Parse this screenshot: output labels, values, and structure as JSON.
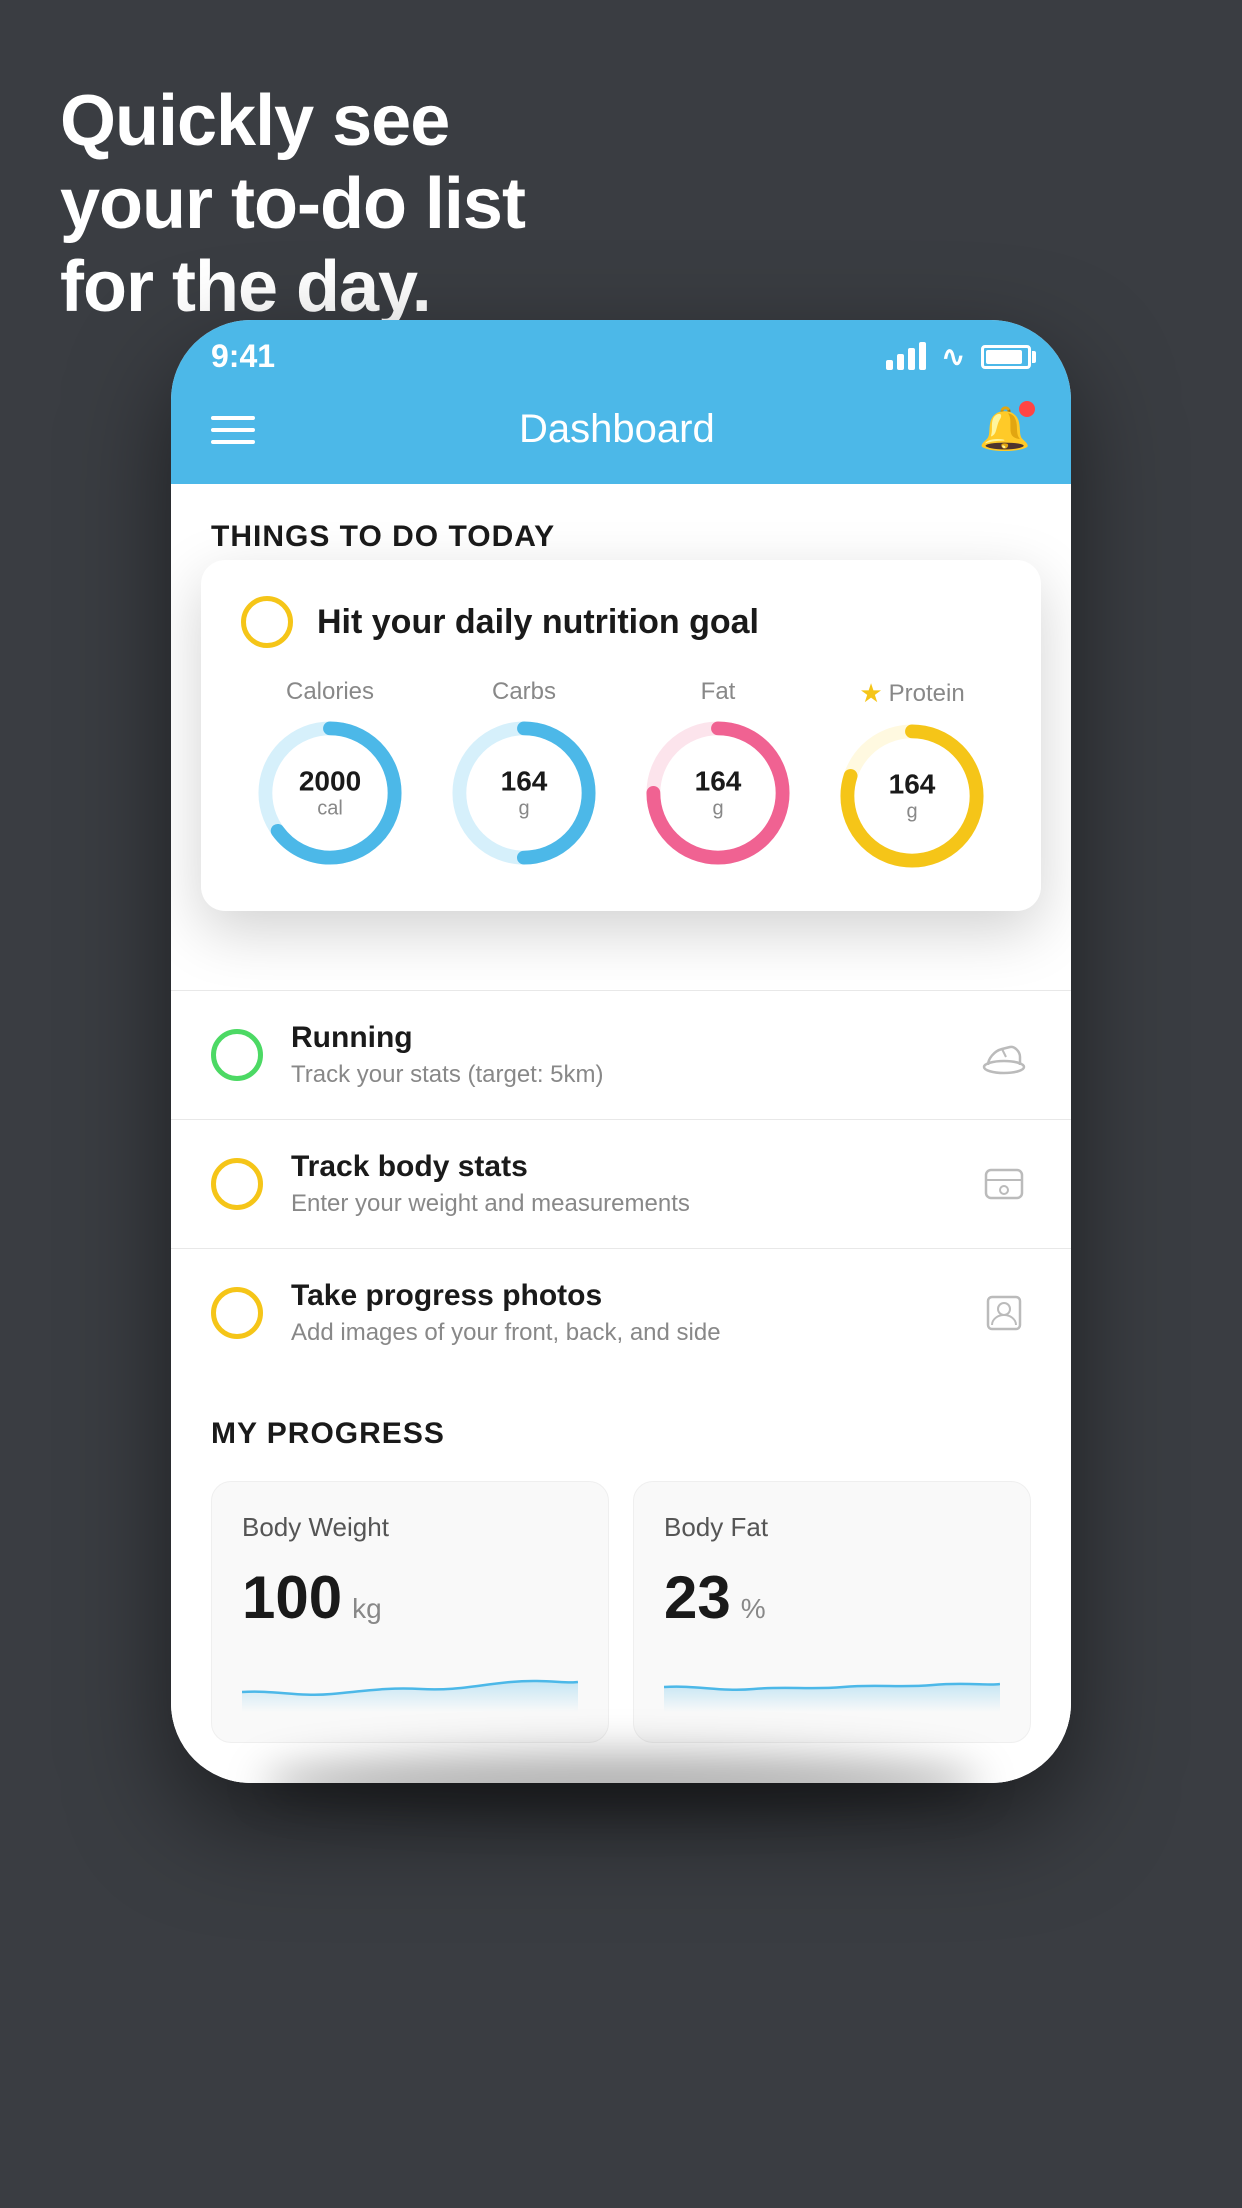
{
  "hero": {
    "line1": "Quickly see",
    "line2": "your to-do list",
    "line3": "for the day."
  },
  "status_bar": {
    "time": "9:41"
  },
  "header": {
    "title": "Dashboard"
  },
  "things_section": {
    "title": "THINGS TO DO TODAY"
  },
  "nutrition_card": {
    "title": "Hit your daily nutrition goal",
    "items": [
      {
        "label": "Calories",
        "value": "2000",
        "unit": "cal",
        "color": "#4cb8e8",
        "bg_color": "#d6f0fb",
        "percent": 65,
        "starred": false
      },
      {
        "label": "Carbs",
        "value": "164",
        "unit": "g",
        "color": "#4cb8e8",
        "bg_color": "#d6f0fb",
        "percent": 50,
        "starred": false
      },
      {
        "label": "Fat",
        "value": "164",
        "unit": "g",
        "color": "#f06292",
        "bg_color": "#fce4ec",
        "percent": 75,
        "starred": false
      },
      {
        "label": "Protein",
        "value": "164",
        "unit": "g",
        "color": "#f5c518",
        "bg_color": "#fff9e0",
        "percent": 80,
        "starred": true
      }
    ]
  },
  "todo_items": [
    {
      "title": "Running",
      "subtitle": "Track your stats (target: 5km)",
      "circle_color": "green",
      "icon": "shoe"
    },
    {
      "title": "Track body stats",
      "subtitle": "Enter your weight and measurements",
      "circle_color": "yellow",
      "icon": "scale"
    },
    {
      "title": "Take progress photos",
      "subtitle": "Add images of your front, back, and side",
      "circle_color": "yellow",
      "icon": "person"
    }
  ],
  "progress_section": {
    "title": "MY PROGRESS",
    "cards": [
      {
        "title": "Body Weight",
        "value": "100",
        "unit": "kg"
      },
      {
        "title": "Body Fat",
        "value": "23",
        "unit": "%"
      }
    ]
  }
}
